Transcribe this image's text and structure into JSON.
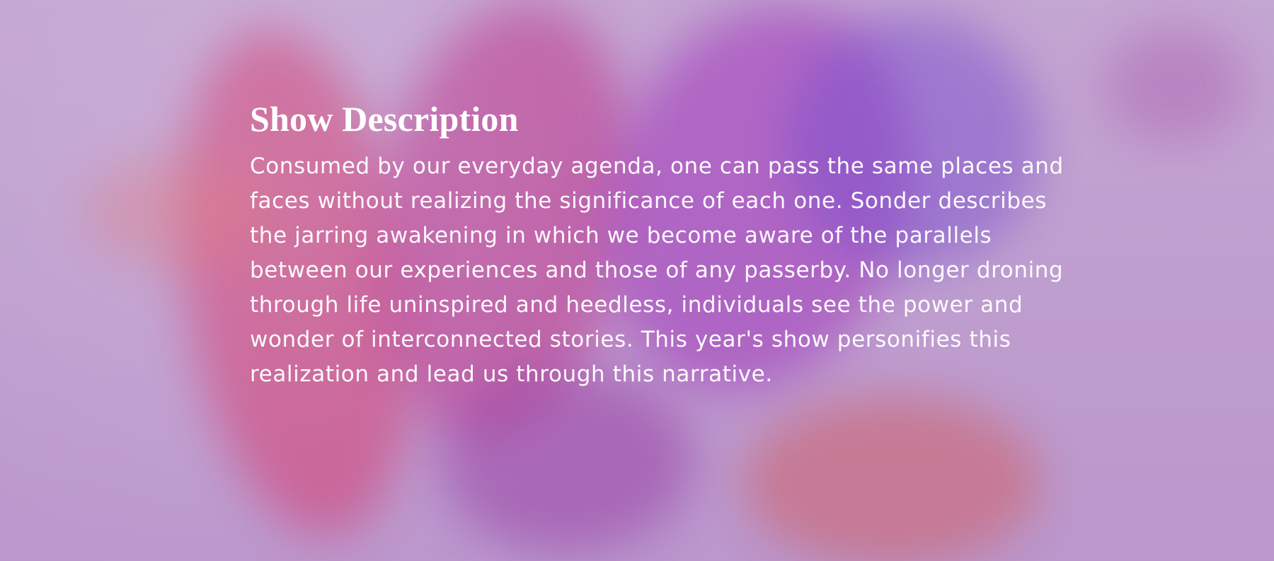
{
  "section": {
    "title": "Show Description",
    "body": "Consumed by our everyday agenda, one can pass the same places and faces without realizing the significance of each one. Sonder describes the jarring awakening in which we become aware of the parallels between our experiences and those of any passerby. No longer droning through life uninspired and heedless, individuals see the power and wonder of interconnected stories. This year's show personifies this realization and lead us through this narrative."
  },
  "colors": {
    "background": "#b89ec6",
    "text": "#ffffff",
    "accent_pink": "#cd4e84",
    "accent_purple": "#a646be"
  }
}
